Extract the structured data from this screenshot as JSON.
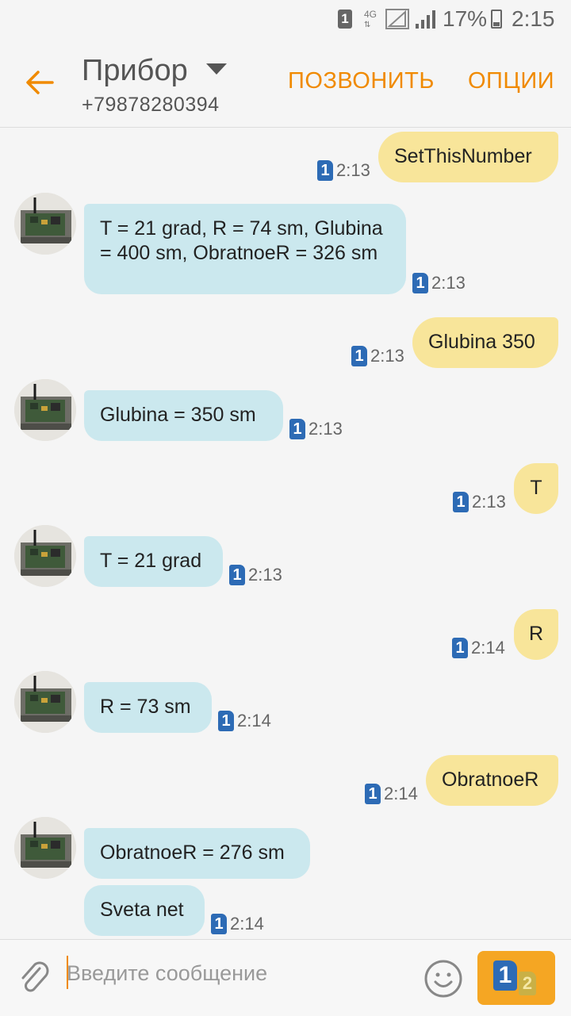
{
  "status_bar": {
    "sim_slot": "1",
    "network": "4G",
    "battery": "17%",
    "time": "2:15"
  },
  "header": {
    "title": "Прибор",
    "phone": "+79878280394",
    "call_label": "ПОЗВОНИТЬ",
    "options_label": "ОПЦИИ"
  },
  "messages": [
    {
      "direction": "out",
      "text": "SetThisNumber",
      "sim": "1",
      "time": "2:13"
    },
    {
      "direction": "in",
      "text": "T = 21 grad, R = 74 sm, Glubina = 400 sm, ObratnoeR = 326 sm",
      "sim": "1",
      "time": "2:13"
    },
    {
      "direction": "out",
      "text": "Glubina 350",
      "sim": "1",
      "time": "2:13"
    },
    {
      "direction": "in",
      "text": "Glubina = 350 sm",
      "sim": "1",
      "time": "2:13"
    },
    {
      "direction": "out",
      "text": "T",
      "sim": "1",
      "time": "2:13"
    },
    {
      "direction": "in",
      "text": "T = 21 grad",
      "sim": "1",
      "time": "2:13"
    },
    {
      "direction": "out",
      "text": "R",
      "sim": "1",
      "time": "2:14"
    },
    {
      "direction": "in",
      "text": "R = 73 sm",
      "sim": "1",
      "time": "2:14"
    },
    {
      "direction": "out",
      "text": "ObratnoeR",
      "sim": "1",
      "time": "2:14"
    },
    {
      "direction": "in",
      "text": "ObratnoeR = 276 sm",
      "sim": "",
      "time": ""
    },
    {
      "direction": "in",
      "text": "Sveta net",
      "sim": "1",
      "time": "2:14"
    }
  ],
  "compose": {
    "placeholder": "Введите сообщение",
    "value": "",
    "send_sim_main": "1",
    "send_sim_badge": "2"
  },
  "colors": {
    "accent": "#f08a00",
    "outgoing_bubble": "#f8e59a",
    "incoming_bubble": "#cbe8ee",
    "sim_badge": "#2d6bb5",
    "send_button": "#f5a623"
  }
}
